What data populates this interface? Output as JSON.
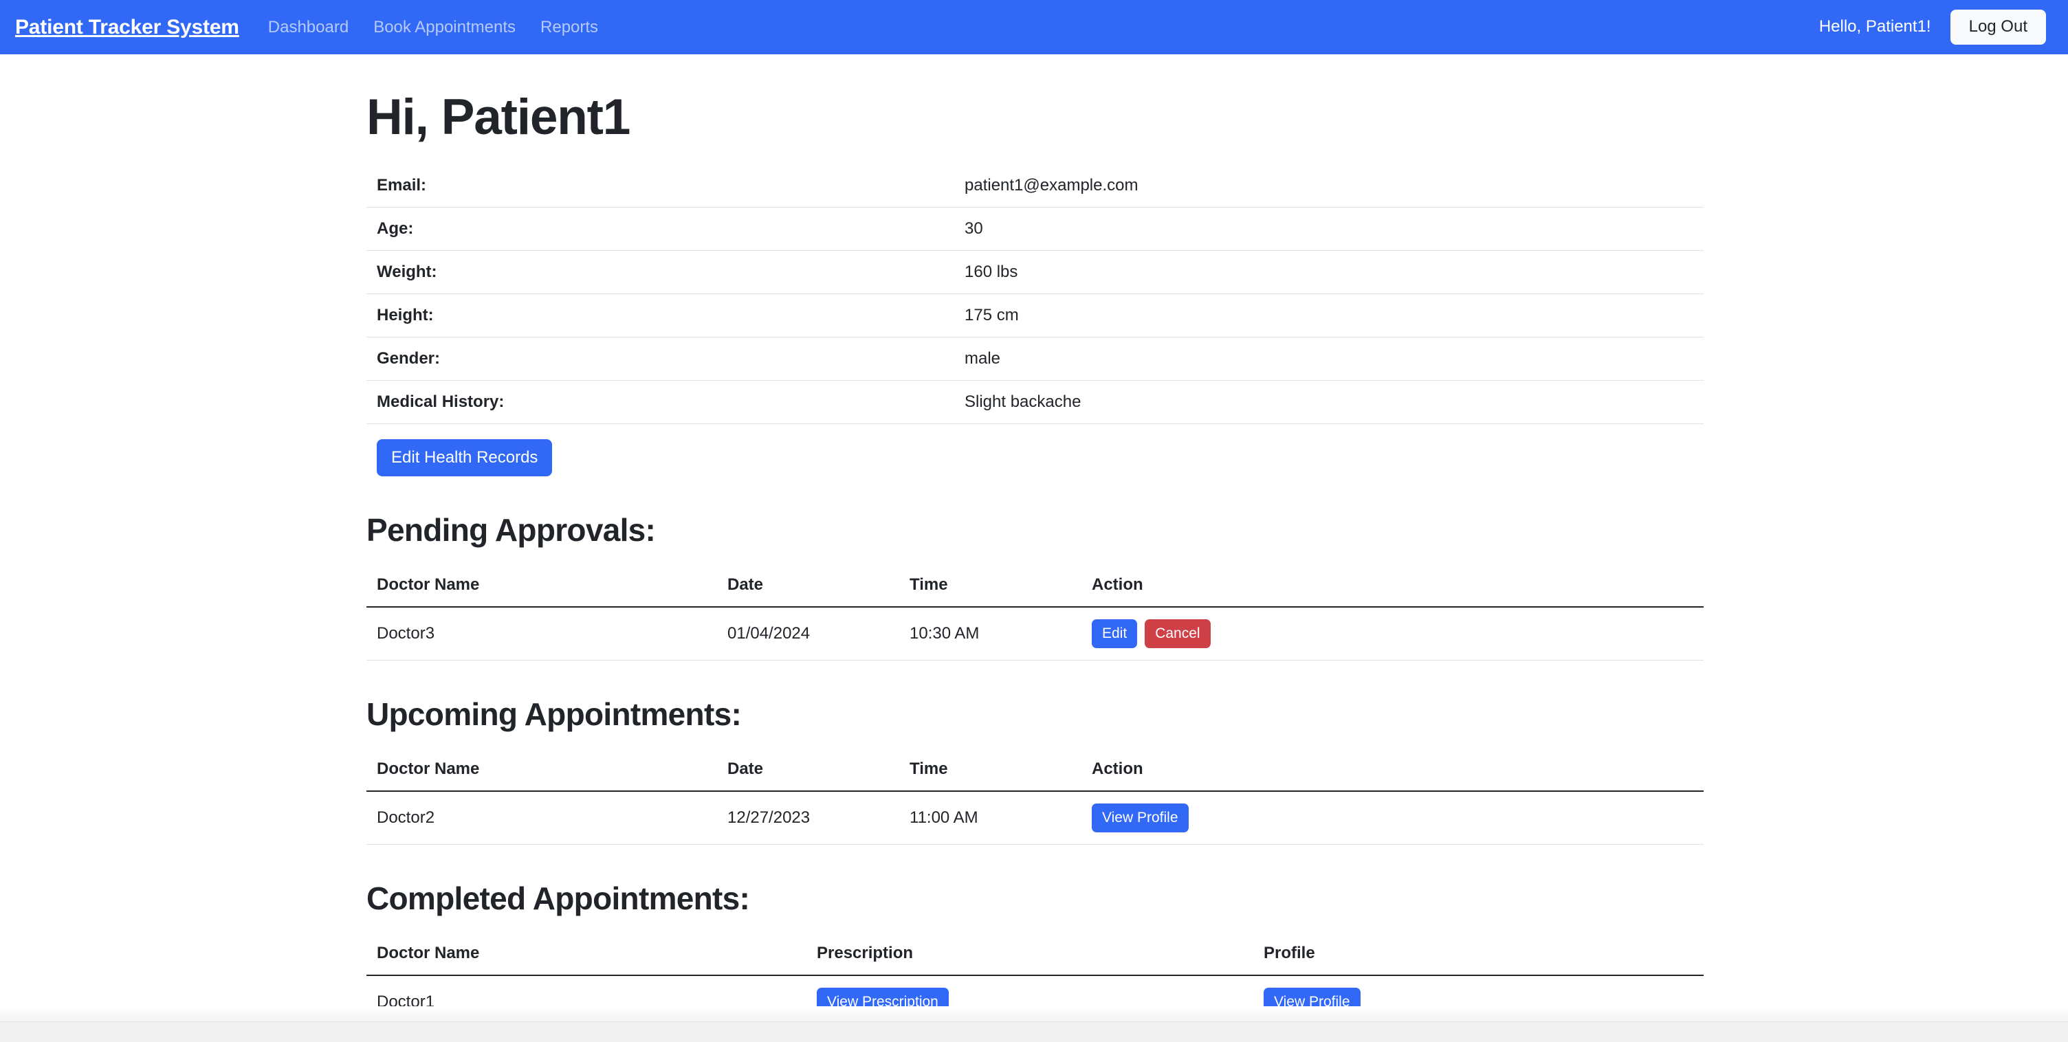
{
  "navbar": {
    "brand": "Patient Tracker System",
    "links": [
      {
        "label": "Dashboard"
      },
      {
        "label": "Book Appointments"
      },
      {
        "label": "Reports"
      }
    ],
    "greeting": "Hello, Patient1!",
    "logout_label": "Log Out"
  },
  "page": {
    "title": "Hi, Patient1"
  },
  "health_info": {
    "rows": [
      {
        "label": "Email:",
        "value": "patient1@example.com"
      },
      {
        "label": "Age:",
        "value": "30"
      },
      {
        "label": "Weight:",
        "value": "160 lbs"
      },
      {
        "label": "Height:",
        "value": "175 cm"
      },
      {
        "label": "Gender:",
        "value": "male"
      },
      {
        "label": "Medical History:",
        "value": "Slight backache"
      }
    ],
    "edit_button_label": "Edit Health Records"
  },
  "pending_approvals": {
    "heading": "Pending Approvals:",
    "headers": [
      "Doctor Name",
      "Date",
      "Time",
      "Action"
    ],
    "rows": [
      {
        "doctor": "Doctor3",
        "date": "01/04/2024",
        "time": "10:30 AM",
        "edit_label": "Edit",
        "cancel_label": "Cancel"
      }
    ]
  },
  "upcoming_appointments": {
    "heading": "Upcoming Appointments:",
    "headers": [
      "Doctor Name",
      "Date",
      "Time",
      "Action"
    ],
    "rows": [
      {
        "doctor": "Doctor2",
        "date": "12/27/2023",
        "time": "11:00 AM",
        "view_profile_label": "View Profile"
      }
    ]
  },
  "completed_appointments": {
    "heading": "Completed Appointments:",
    "headers": [
      "Doctor Name",
      "Prescription",
      "Profile"
    ],
    "rows": [
      {
        "doctor": "Doctor1",
        "view_prescription_label": "View Prescription",
        "view_profile_label": "View Profile"
      }
    ]
  },
  "colors": {
    "brand_blue": "#3169f6",
    "danger_red": "#cf4046",
    "light_button": "#f8f9fa",
    "text": "#212529",
    "rule": "#dee2e6"
  }
}
